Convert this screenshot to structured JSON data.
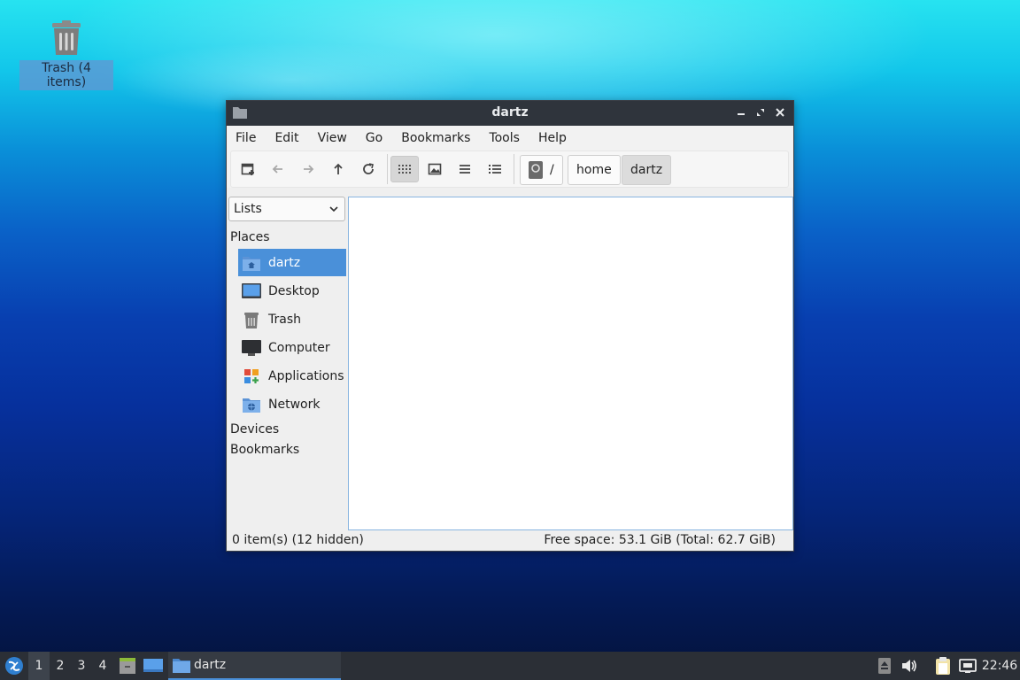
{
  "desktop": {
    "trash_label": "Trash (4 items)"
  },
  "window": {
    "title": "dartz",
    "menu": [
      "File",
      "Edit",
      "View",
      "Go",
      "Bookmarks",
      "Tools",
      "Help"
    ],
    "breadcrumbs": [
      "/",
      "home",
      "dartz"
    ],
    "sidebar": {
      "dropdown_value": "Lists",
      "places_label": "Places",
      "places": [
        {
          "label": "dartz",
          "icon": "home-folder-icon",
          "selected": true
        },
        {
          "label": "Desktop",
          "icon": "desktop-icon"
        },
        {
          "label": "Trash",
          "icon": "trash-icon"
        },
        {
          "label": "Computer",
          "icon": "computer-icon"
        },
        {
          "label": "Applications",
          "icon": "applications-icon"
        },
        {
          "label": "Network",
          "icon": "network-folder-icon"
        }
      ],
      "devices_label": "Devices",
      "bookmarks_label": "Bookmarks"
    },
    "status": {
      "left": "0 item(s) (12 hidden)",
      "right": "Free space: 53.1 GiB (Total: 62.7 GiB)"
    }
  },
  "taskbar": {
    "workspaces": [
      "1",
      "2",
      "3",
      "4"
    ],
    "active_workspace": "1",
    "task_label": "dartz",
    "clock": "22:46"
  },
  "colors": {
    "accent": "#4a90d9",
    "titlebar": "#2f343c",
    "taskbar": "#2b2f36"
  }
}
